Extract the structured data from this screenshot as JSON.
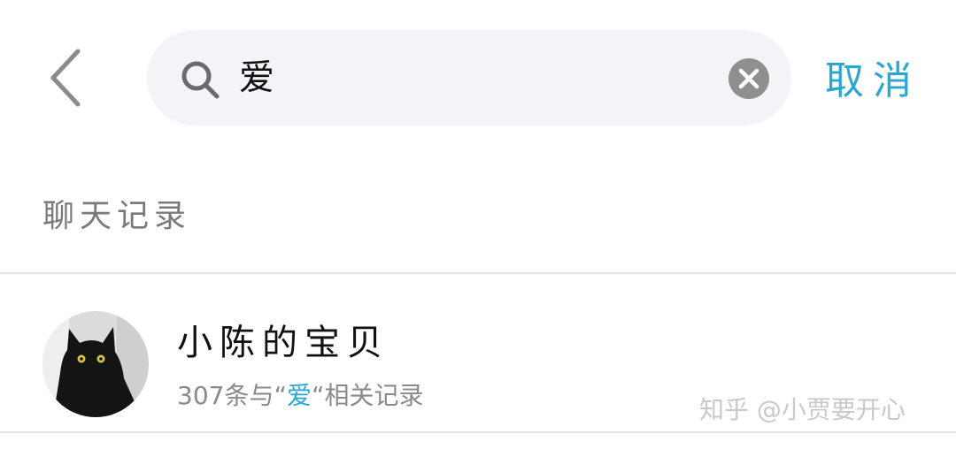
{
  "header": {
    "search_query": "爱",
    "cancel_label": "取消"
  },
  "section": {
    "label": "聊天记录"
  },
  "results": [
    {
      "title": "小陈的宝贝",
      "count": "307",
      "count_suffix": "条与",
      "keyword_open": "“",
      "keyword": "爱",
      "keyword_close": "“",
      "record_suffix": "相关记录"
    }
  ],
  "watermark": "知乎 @小贾要开心",
  "colors": {
    "accent": "#2aa7cf",
    "search_bg": "#f3f4f8",
    "divider": "#e4e4e4",
    "secondary_text": "#8a8a8a"
  },
  "icons": {
    "back": "chevron-left-icon",
    "search": "search-icon",
    "clear": "clear-circle-icon",
    "avatar": "black-cat-avatar"
  }
}
